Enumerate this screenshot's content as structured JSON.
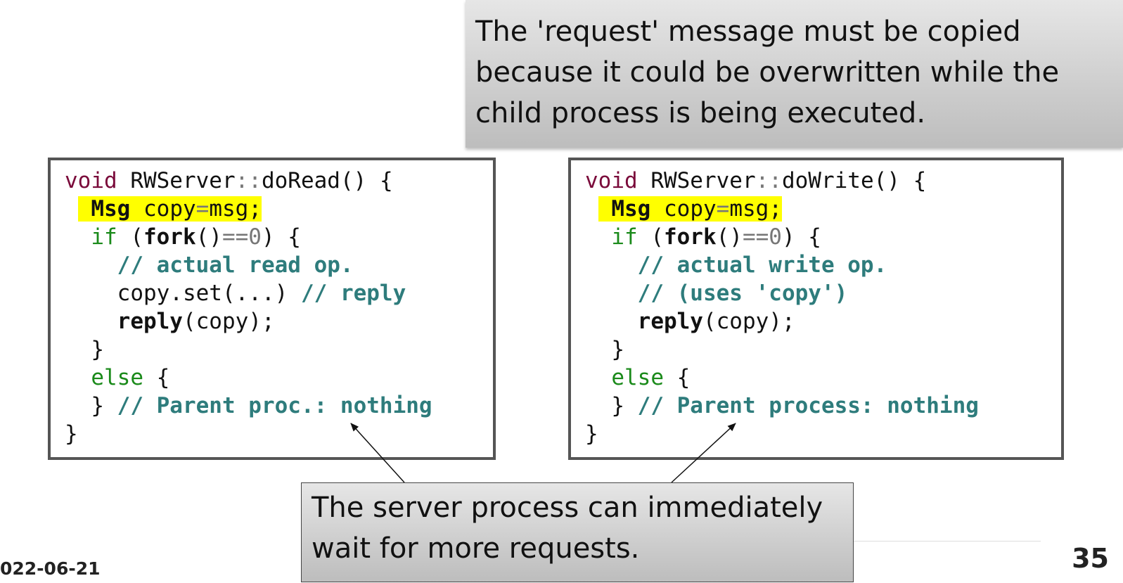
{
  "callout_top": {
    "lines": [
      "The 'request' message must be copied",
      "because it could be overwritten while the",
      "child process is being executed."
    ]
  },
  "callout_bottom": {
    "lines": [
      "The server process can immediately",
      "wait for more requests."
    ]
  },
  "code_left": {
    "l1_kw": "void",
    "l1_rest": " RWServer",
    "l1_sep": "::",
    "l1_fn": "doRead() {",
    "l2_type": "Msg",
    "l2_a": " copy",
    "l2_eq": "=",
    "l2_b": "msg;",
    "l3_if": "if",
    "l3_a": " (",
    "l3_fork": "fork",
    "l3_b": "()",
    "l3_eq": "==",
    "l3_zero": "0",
    "l3_c": ") {",
    "l4_cm": "// actual read op.",
    "l5_a": "copy.set(...) ",
    "l5_cm": "// reply",
    "l6_reply": "reply",
    "l6_rest": "(copy);",
    "l7": "}",
    "l8_else": "else",
    "l8_rest": " {",
    "l9_a": "} ",
    "l9_cm": "// Parent proc.: nothing",
    "l10": "}"
  },
  "code_right": {
    "l1_kw": "void",
    "l1_rest": " RWServer",
    "l1_sep": "::",
    "l1_fn": "doWrite() {",
    "l2_type": "Msg",
    "l2_a": " copy",
    "l2_eq": "=",
    "l2_b": "msg;",
    "l3_if": "if",
    "l3_a": " (",
    "l3_fork": "fork",
    "l3_b": "()",
    "l3_eq": "==",
    "l3_zero": "0",
    "l3_c": ") {",
    "l4_cm": "// actual write op.",
    "l5_cm": "// (uses 'copy')",
    "l6_reply": "reply",
    "l6_rest": "(copy);",
    "l7": "}",
    "l8_else": "else",
    "l8_rest": " {",
    "l9_a": "} ",
    "l9_cm": "// Parent process: nothing",
    "l10": "}"
  },
  "footer": {
    "date": "022-06-21",
    "page_number": "35"
  },
  "colors": {
    "keyword": "#7a0a3a",
    "control": "#1a8a1a",
    "comment": "#2e7c7c",
    "highlight": "#ffff00",
    "callout_bg": "#cdcdcd"
  }
}
